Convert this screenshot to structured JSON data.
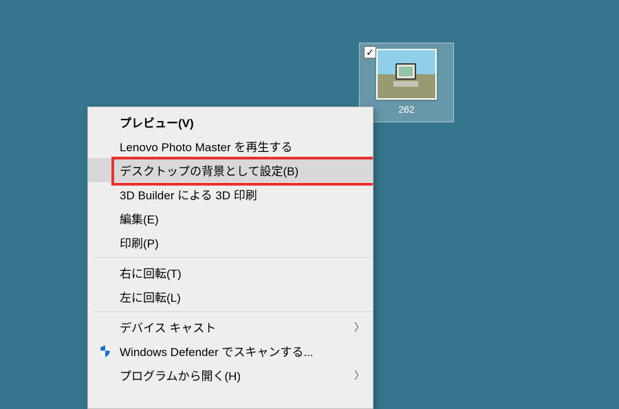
{
  "desktop": {
    "icon": {
      "checked": true,
      "label": "262"
    }
  },
  "menu": {
    "items": [
      {
        "label": "プレビュー(V)",
        "bold": true
      },
      {
        "label": "Lenovo Photo Master を再生する"
      },
      {
        "label": "デスクトップの背景として設定(B)",
        "hover": true,
        "highlight": true
      },
      {
        "label": "3D Builder による 3D 印刷"
      },
      {
        "label": "編集(E)"
      },
      {
        "label": "印刷(P)"
      }
    ],
    "group2": [
      {
        "label": "右に回転(T)"
      },
      {
        "label": "左に回転(L)"
      }
    ],
    "group3": [
      {
        "label": "デバイス キャスト",
        "submenu": true
      },
      {
        "label": "Windows Defender でスキャンする...",
        "icon": "defender"
      },
      {
        "label": "プログラムから開く(H)",
        "submenu": true
      }
    ]
  }
}
